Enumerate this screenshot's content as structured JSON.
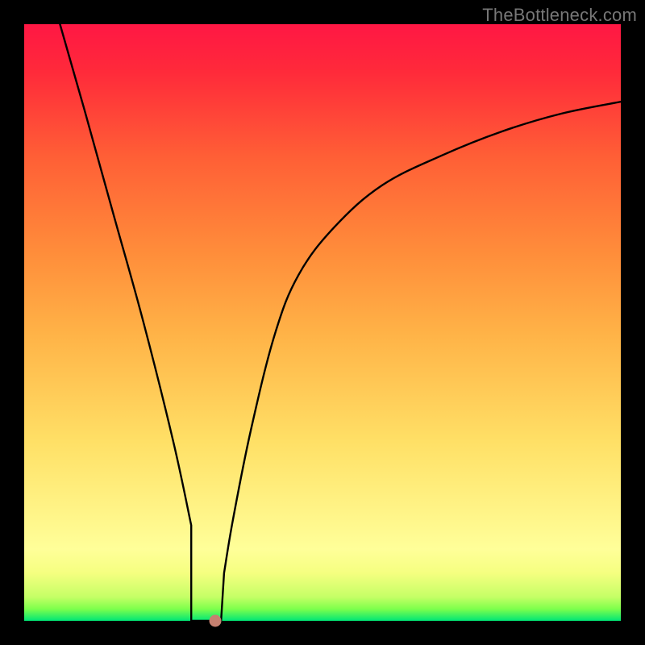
{
  "watermark": "TheBottleneck.com",
  "chart_data": {
    "type": "line",
    "title": "",
    "xlabel": "",
    "ylabel": "",
    "xlim": [
      0,
      100
    ],
    "ylim": [
      0,
      100
    ],
    "grid": false,
    "legend": false,
    "curve": {
      "x": [
        6,
        10,
        15,
        20,
        25,
        28,
        29.5,
        30.5,
        31.5,
        32.5,
        33.5,
        35,
        38,
        42,
        46,
        52,
        60,
        70,
        80,
        90,
        100
      ],
      "y": [
        100,
        86,
        68,
        50,
        30,
        16,
        8,
        2,
        0,
        2,
        8,
        17,
        32,
        48,
        58,
        66,
        73,
        78,
        82,
        85,
        87
      ]
    },
    "flat_bottom": {
      "x_start": 28,
      "x_end": 33,
      "y": 0
    },
    "marker": {
      "x": 32,
      "y": 0,
      "color": "#c58070"
    }
  },
  "colors": {
    "bg_top": "#ff1744",
    "bg_bottom": "#00e676",
    "curve": "#000000",
    "frame": "#000000",
    "marker": "#c58070",
    "watermark": "#777777"
  }
}
